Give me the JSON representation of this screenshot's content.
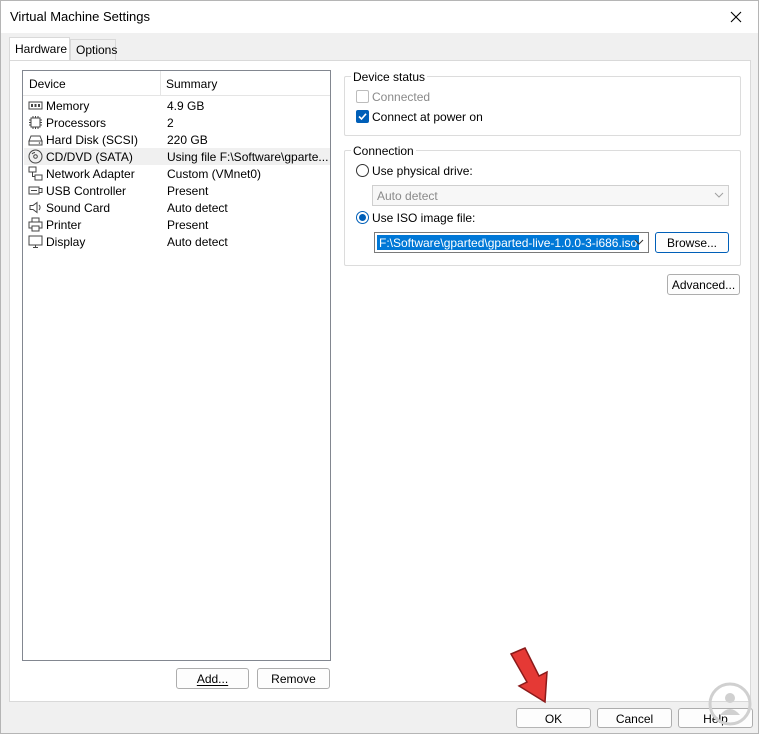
{
  "window": {
    "title": "Virtual Machine Settings"
  },
  "tabs": [
    {
      "label": "Hardware",
      "active": true
    },
    {
      "label": "Options",
      "active": false
    }
  ],
  "device_list": {
    "columns": [
      "Device",
      "Summary"
    ],
    "rows": [
      {
        "device": "Memory",
        "summary": "4.9 GB",
        "icon": "memory-icon"
      },
      {
        "device": "Processors",
        "summary": "2",
        "icon": "processor-icon"
      },
      {
        "device": "Hard Disk (SCSI)",
        "summary": "220 GB",
        "icon": "hard-disk-icon"
      },
      {
        "device": "CD/DVD (SATA)",
        "summary": "Using file F:\\Software\\gparte...",
        "icon": "cd-dvd-icon",
        "selected": true
      },
      {
        "device": "Network Adapter",
        "summary": "Custom (VMnet0)",
        "icon": "network-adapter-icon"
      },
      {
        "device": "USB Controller",
        "summary": "Present",
        "icon": "usb-icon"
      },
      {
        "device": "Sound Card",
        "summary": "Auto detect",
        "icon": "speaker-icon"
      },
      {
        "device": "Printer",
        "summary": "Present",
        "icon": "printer-icon"
      },
      {
        "device": "Display",
        "summary": "Auto detect",
        "icon": "display-icon"
      }
    ]
  },
  "list_buttons": {
    "add": "Add...",
    "remove": "Remove"
  },
  "device_status": {
    "title": "Device status",
    "connected_label": "Connected",
    "connected_checked": false,
    "connected_disabled": true,
    "power_on_label": "Connect at power on",
    "power_on_checked": true
  },
  "connection": {
    "title": "Connection",
    "physical_label": "Use physical drive:",
    "physical_selected": false,
    "physical_value": "Auto detect",
    "iso_label": "Use ISO image file:",
    "iso_selected": true,
    "iso_value": "F:\\Software\\gparted\\gparted-live-1.0.0-3-i686.iso",
    "browse_label": "Browse..."
  },
  "advanced_label": "Advanced...",
  "footer": {
    "ok": "OK",
    "cancel": "Cancel",
    "help": "Help"
  },
  "colors": {
    "accent": "#005fb8",
    "selection": "#0078d7",
    "annotation_arrow": "#e53935"
  }
}
